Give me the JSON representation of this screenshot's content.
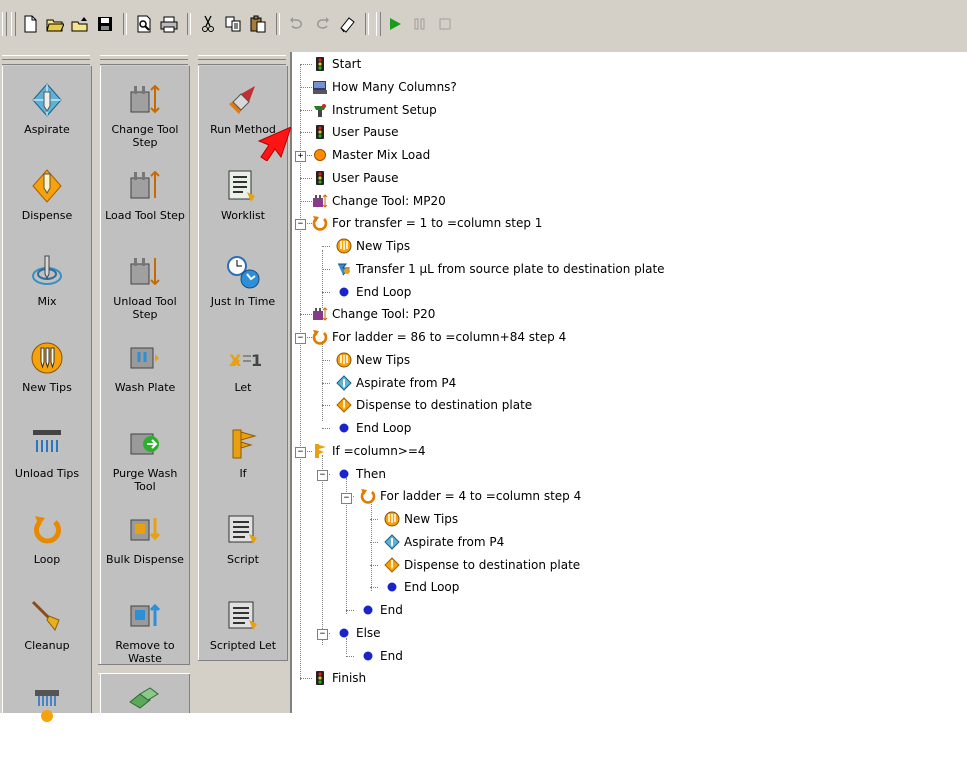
{
  "toolbar": {
    "buttons": [
      {
        "name": "new",
        "icon": "new-file-icon"
      },
      {
        "name": "open",
        "icon": "open-folder-icon"
      },
      {
        "name": "open-alt",
        "icon": "open-folder-arrow-icon"
      },
      {
        "name": "save",
        "icon": "save-disk-icon"
      },
      {
        "name": "print-preview",
        "icon": "print-preview-icon"
      },
      {
        "name": "print",
        "icon": "printer-icon"
      },
      {
        "name": "cut",
        "icon": "scissors-icon"
      },
      {
        "name": "copy",
        "icon": "copy-icon"
      },
      {
        "name": "paste",
        "icon": "paste-icon"
      },
      {
        "name": "undo",
        "icon": "undo-icon"
      },
      {
        "name": "redo",
        "icon": "redo-icon"
      },
      {
        "name": "erase",
        "icon": "eraser-icon"
      },
      {
        "name": "run",
        "icon": "play-icon"
      },
      {
        "name": "pause",
        "icon": "pause-icon"
      },
      {
        "name": "stop",
        "icon": "stop-icon"
      }
    ]
  },
  "palette": {
    "col1": [
      "Aspirate",
      "Dispense",
      "Mix",
      "New Tips",
      "Unload Tips",
      "Loop",
      "Cleanup"
    ],
    "col2": [
      "Change Tool Step",
      "Load Tool Step",
      "Unload Tool Step",
      "Wash Plate",
      "Purge Wash Tool",
      "Bulk Dispense",
      "Remove to Waste"
    ],
    "col3": [
      "Run Method",
      "Worklist",
      "Just In Time",
      "Let",
      "If",
      "Script",
      "Scripted Let"
    ]
  },
  "tree": [
    {
      "text": "Start",
      "icon": "traffic-light-icon"
    },
    {
      "text": "How Many Columns?",
      "icon": "keyboard-prompt-icon"
    },
    {
      "text": "Instrument Setup",
      "icon": "instrument-setup-icon"
    },
    {
      "text": "User Pause",
      "icon": "traffic-light-icon"
    },
    {
      "text": "Master Mix Load",
      "icon": "orange-dot-icon"
    },
    {
      "text": "User Pause",
      "icon": "traffic-light-icon"
    },
    {
      "text": "Change Tool: MP20",
      "icon": "change-tool-icon"
    },
    {
      "text": "For transfer = 1 to =column step 1",
      "icon": "loop-icon"
    },
    {
      "text": "New Tips",
      "icon": "new-tips-icon"
    },
    {
      "text": "Transfer 1 µL from source plate to destination plate",
      "icon": "transfer-icon"
    },
    {
      "text": "End Loop",
      "icon": "blue-dot-icon"
    },
    {
      "text": "Change Tool: P20",
      "icon": "change-tool-icon"
    },
    {
      "text": "For ladder = 86 to =column+84 step 4",
      "icon": "loop-icon"
    },
    {
      "text": "New Tips",
      "icon": "new-tips-icon"
    },
    {
      "text": "Aspirate from P4",
      "icon": "aspirate-icon"
    },
    {
      "text": "Dispense to destination plate",
      "icon": "dispense-icon"
    },
    {
      "text": "End Loop",
      "icon": "blue-dot-icon"
    },
    {
      "text": "If =column>=4",
      "icon": "if-icon"
    },
    {
      "text": "Then",
      "icon": "blue-dot-icon"
    },
    {
      "text": "For ladder = 4 to =column step 4",
      "icon": "loop-icon"
    },
    {
      "text": "New Tips",
      "icon": "new-tips-icon"
    },
    {
      "text": "Aspirate from P4",
      "icon": "aspirate-icon"
    },
    {
      "text": "Dispense to destination plate",
      "icon": "dispense-icon"
    },
    {
      "text": "End Loop",
      "icon": "blue-dot-icon"
    },
    {
      "text": "End",
      "icon": "blue-dot-icon"
    },
    {
      "text": "Else",
      "icon": "blue-dot-icon"
    },
    {
      "text": "End",
      "icon": "blue-dot-icon"
    },
    {
      "text": "Finish",
      "icon": "traffic-light-icon"
    }
  ],
  "colors": {
    "accent": "#ff9900",
    "loop": "#d97a00",
    "blue_dot": "#1a24c8",
    "cursor": "#ff0000",
    "face": "#d4d0c8"
  }
}
